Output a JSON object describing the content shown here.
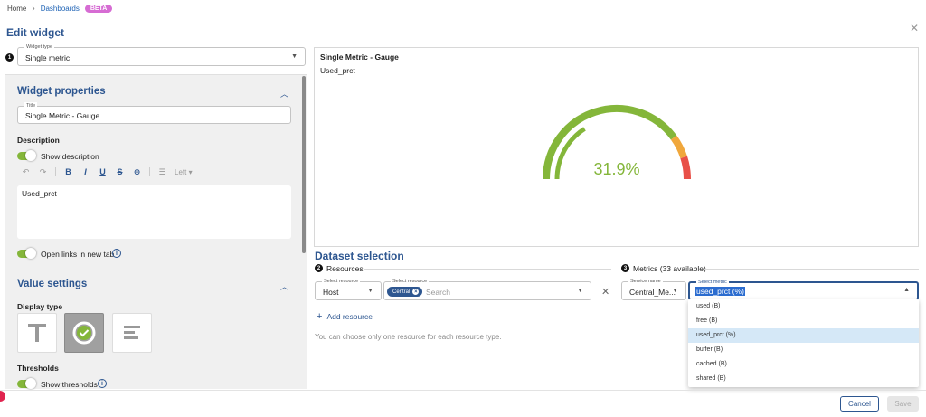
{
  "breadcrumb": {
    "home": "Home",
    "dashboards": "Dashboards",
    "badge": "BETA"
  },
  "page_title": "Edit widget",
  "widget_type": {
    "label": "Widget type",
    "value": "Single metric",
    "step": "1"
  },
  "widget_properties": {
    "title": "Widget properties",
    "title_field_label": "Title",
    "title_value": "Single Metric - Gauge",
    "description_heading": "Description",
    "show_description": "Show description",
    "alignment": "Left",
    "description_text": "Used_prct",
    "open_links": "Open links in new tab"
  },
  "value_settings": {
    "title": "Value settings",
    "display_type_heading": "Display type",
    "display_types": [
      "text-icon",
      "gauge-icon",
      "bar-icon"
    ],
    "selected_display_type": "gauge",
    "thresholds_heading": "Thresholds",
    "show_thresholds": "Show thresholds"
  },
  "preview": {
    "title": "Single Metric - Gauge",
    "description": "Used_prct",
    "value_text": "31.9%",
    "value": 31.9,
    "max": 100,
    "colors": {
      "ok": "#84b63a",
      "warning": "#f0a73c",
      "critical": "#e85048"
    }
  },
  "dataset": {
    "title": "Dataset selection",
    "resources_heading": "Resources",
    "resources_step": "2",
    "select_resource_label": "Select resource",
    "resource_type": "Host",
    "selected_resource_chip": "Central",
    "search_placeholder": "Search",
    "add_resource": "Add resource",
    "hint": "You can choose only one resource for each resource type.",
    "metrics_heading": "Metrics (33 available)",
    "metrics_step": "3",
    "service_label": "Service name",
    "service_value": "Central_Me...",
    "metric_label": "Select metric",
    "metric_value": "used_prct (%)",
    "metric_options": [
      "used (B)",
      "free (B)",
      "used_prct (%)",
      "buffer (B)",
      "cached (B)",
      "shared (B)"
    ],
    "selected_metric_index": 2
  },
  "footer": {
    "cancel": "Cancel",
    "save": "Save"
  }
}
